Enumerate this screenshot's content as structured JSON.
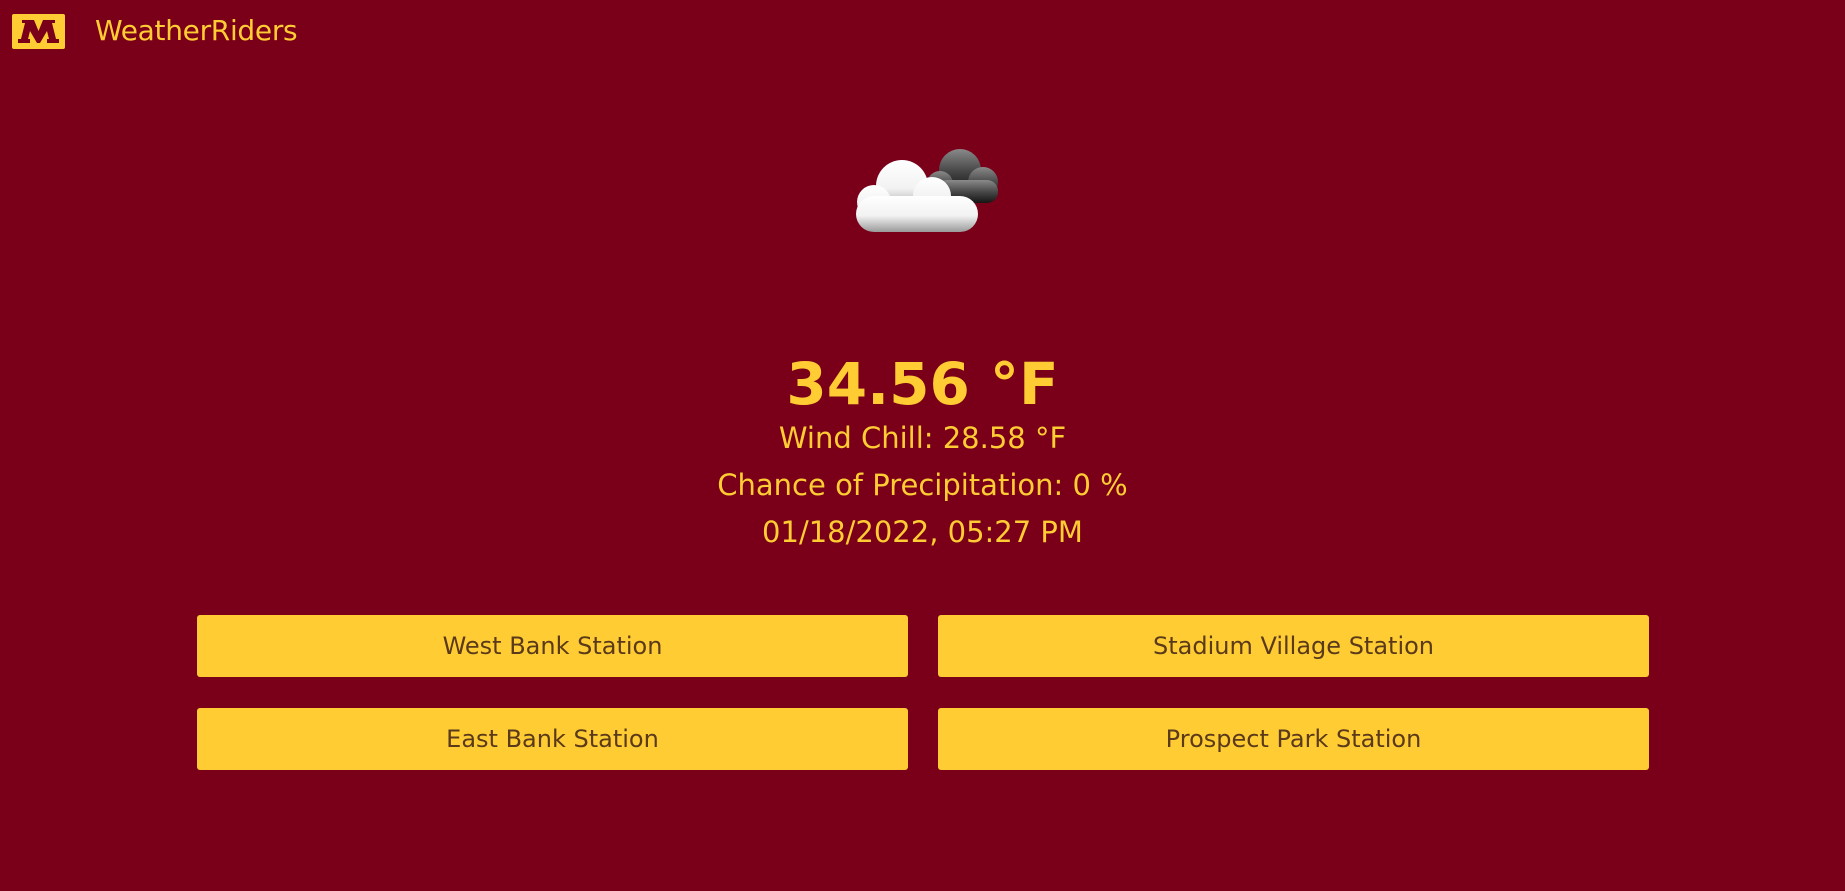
{
  "header": {
    "logo_icon": "university-m-logo-icon",
    "app_title": "WeatherRiders"
  },
  "weather": {
    "icon": "partly-cloudy-night-icon",
    "temperature": "34.56 °F",
    "wind_chill": "Wind Chill: 28.58 °F",
    "precipitation": "Chance of Precipitation: 0 %",
    "datetime": "01/18/2022, 05:27 PM"
  },
  "stations": [
    {
      "label": "West Bank Station"
    },
    {
      "label": "Stadium Village Station"
    },
    {
      "label": "East Bank Station"
    },
    {
      "label": "Prospect Park Station"
    }
  ],
  "colors": {
    "background": "#7a0019",
    "accent": "#ffcc33",
    "button_text": "#5a3a1a"
  }
}
